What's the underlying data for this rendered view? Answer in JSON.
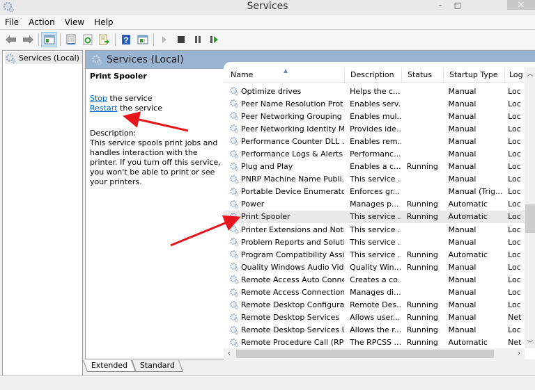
{
  "window": {
    "title": "Services",
    "minimize": "–",
    "maximize": "□",
    "close": "✕"
  },
  "menu": [
    "File",
    "Action",
    "View",
    "Help"
  ],
  "toolbar": {
    "icons": [
      "back-icon",
      "forward-icon",
      "show-hide-console-tree-icon",
      "properties-icon",
      "refresh-icon",
      "export-list-icon",
      "help-icon",
      "show-hide-action-pane-icon",
      "start-service-icon",
      "stop-service-icon",
      "pause-service-icon",
      "resume-service-icon"
    ]
  },
  "tree": {
    "item": "Services (Local)"
  },
  "pane": {
    "title": "Services (Local)",
    "selected_service": "Print Spooler",
    "stop_link": "Stop",
    "stop_suffix": " the service",
    "restart_link": "Restart",
    "restart_suffix": " the service",
    "description_label": "Description:",
    "description_text": "This service spools print jobs and handles interaction with the printer. If you turn off this service, you won't be able to print or see your printers."
  },
  "list": {
    "columns": [
      "Name",
      "Description",
      "Status",
      "Startup Type",
      "Log"
    ],
    "rows": [
      {
        "name": "Optimize drives",
        "desc": "Helps the c...",
        "status": "",
        "startup": "Manual",
        "log": "Loc"
      },
      {
        "name": "Peer Name Resolution Prot...",
        "desc": "Enables serv...",
        "status": "",
        "startup": "Manual",
        "log": "Loc"
      },
      {
        "name": "Peer Networking Grouping",
        "desc": "Enables mul...",
        "status": "",
        "startup": "Manual",
        "log": "Loc"
      },
      {
        "name": "Peer Networking Identity M...",
        "desc": "Provides ide...",
        "status": "",
        "startup": "Manual",
        "log": "Loc"
      },
      {
        "name": "Performance Counter DLL ...",
        "desc": "Enables rem...",
        "status": "",
        "startup": "Manual",
        "log": "Loc"
      },
      {
        "name": "Performance Logs & Alerts",
        "desc": "Performanc...",
        "status": "",
        "startup": "Manual",
        "log": "Loc"
      },
      {
        "name": "Plug and Play",
        "desc": "Enables a c...",
        "status": "Running",
        "startup": "Manual",
        "log": "Loc"
      },
      {
        "name": "PNRP Machine Name Publi...",
        "desc": "This service ...",
        "status": "",
        "startup": "Manual",
        "log": "Loc"
      },
      {
        "name": "Portable Device Enumerator...",
        "desc": "Enforces gr...",
        "status": "",
        "startup": "Manual (Trig...",
        "log": "Loc"
      },
      {
        "name": "Power",
        "desc": "Manages p...",
        "status": "Running",
        "startup": "Automatic",
        "log": "Loc"
      },
      {
        "name": "Print Spooler",
        "desc": "This service ...",
        "status": "Running",
        "startup": "Automatic",
        "log": "Loc",
        "selected": true
      },
      {
        "name": "Printer Extensions and Notif...",
        "desc": "This service ...",
        "status": "",
        "startup": "Manual",
        "log": "Loc"
      },
      {
        "name": "Problem Reports and Soluti...",
        "desc": "This service ...",
        "status": "",
        "startup": "Manual",
        "log": "Loc"
      },
      {
        "name": "Program Compatibility Assi...",
        "desc": "This service ...",
        "status": "Running",
        "startup": "Automatic",
        "log": "Loc"
      },
      {
        "name": "Quality Windows Audio Vid...",
        "desc": "Quality Win...",
        "status": "Running",
        "startup": "Manual",
        "log": "Loc"
      },
      {
        "name": "Remote Access Auto Conne...",
        "desc": "Creates a co...",
        "status": "",
        "startup": "Manual",
        "log": "Loc"
      },
      {
        "name": "Remote Access Connection...",
        "desc": "Manages di...",
        "status": "",
        "startup": "Manual",
        "log": "Loc"
      },
      {
        "name": "Remote Desktop Configurat...",
        "desc": "Remote Des...",
        "status": "Running",
        "startup": "Manual",
        "log": "Loc"
      },
      {
        "name": "Remote Desktop Services",
        "desc": "Allows user...",
        "status": "Running",
        "startup": "Manual",
        "log": "Net"
      },
      {
        "name": "Remote Desktop Services U...",
        "desc": "Allows the r...",
        "status": "Running",
        "startup": "Manual",
        "log": "Loc"
      },
      {
        "name": "Remote Procedure Call (RPC)",
        "desc": "The RPCSS ...",
        "status": "Running",
        "startup": "Automatic",
        "log": "Net"
      }
    ]
  },
  "tabs": [
    "Extended",
    "Standard"
  ],
  "colors": {
    "header_blue": "#99b4d1",
    "link": "#0066cc",
    "annotation_arrow": "#e8141c",
    "selected_row": "#e9e9e9"
  }
}
